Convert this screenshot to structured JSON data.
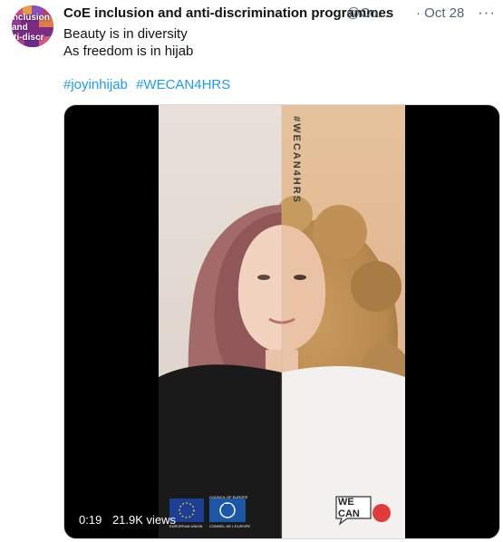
{
  "tweet": {
    "avatar_lines": [
      "inclusion",
      "and",
      "nti-discr"
    ],
    "author_name": "CoE inclusion and anti-discrimination programmes",
    "handle": "@Co...",
    "date": "· Oct 28",
    "more": "···",
    "text_lines": [
      "Beauty is in diversity",
      "As freedom is in hijab"
    ],
    "hashtags": [
      "#joyinhijab",
      "#WECAN4HRS"
    ]
  },
  "media": {
    "vertical_hashtag": "#WECAN4HRS",
    "duration": "0:19",
    "views": "21.9K views",
    "logo_we": "WE",
    "logo_can": "CAN",
    "eu_label": "EUROPEAN UNION",
    "coe_label": "CONSEIL DE L'EUROPE",
    "coe_top": "COUNCIL OF EUROPE"
  },
  "colors": {
    "link": "#1d9bf0",
    "secondary_text": "#536471",
    "eu_blue": "#1b3f95",
    "coe_blue": "#1c56a6",
    "hijab": "#a36a6a"
  }
}
